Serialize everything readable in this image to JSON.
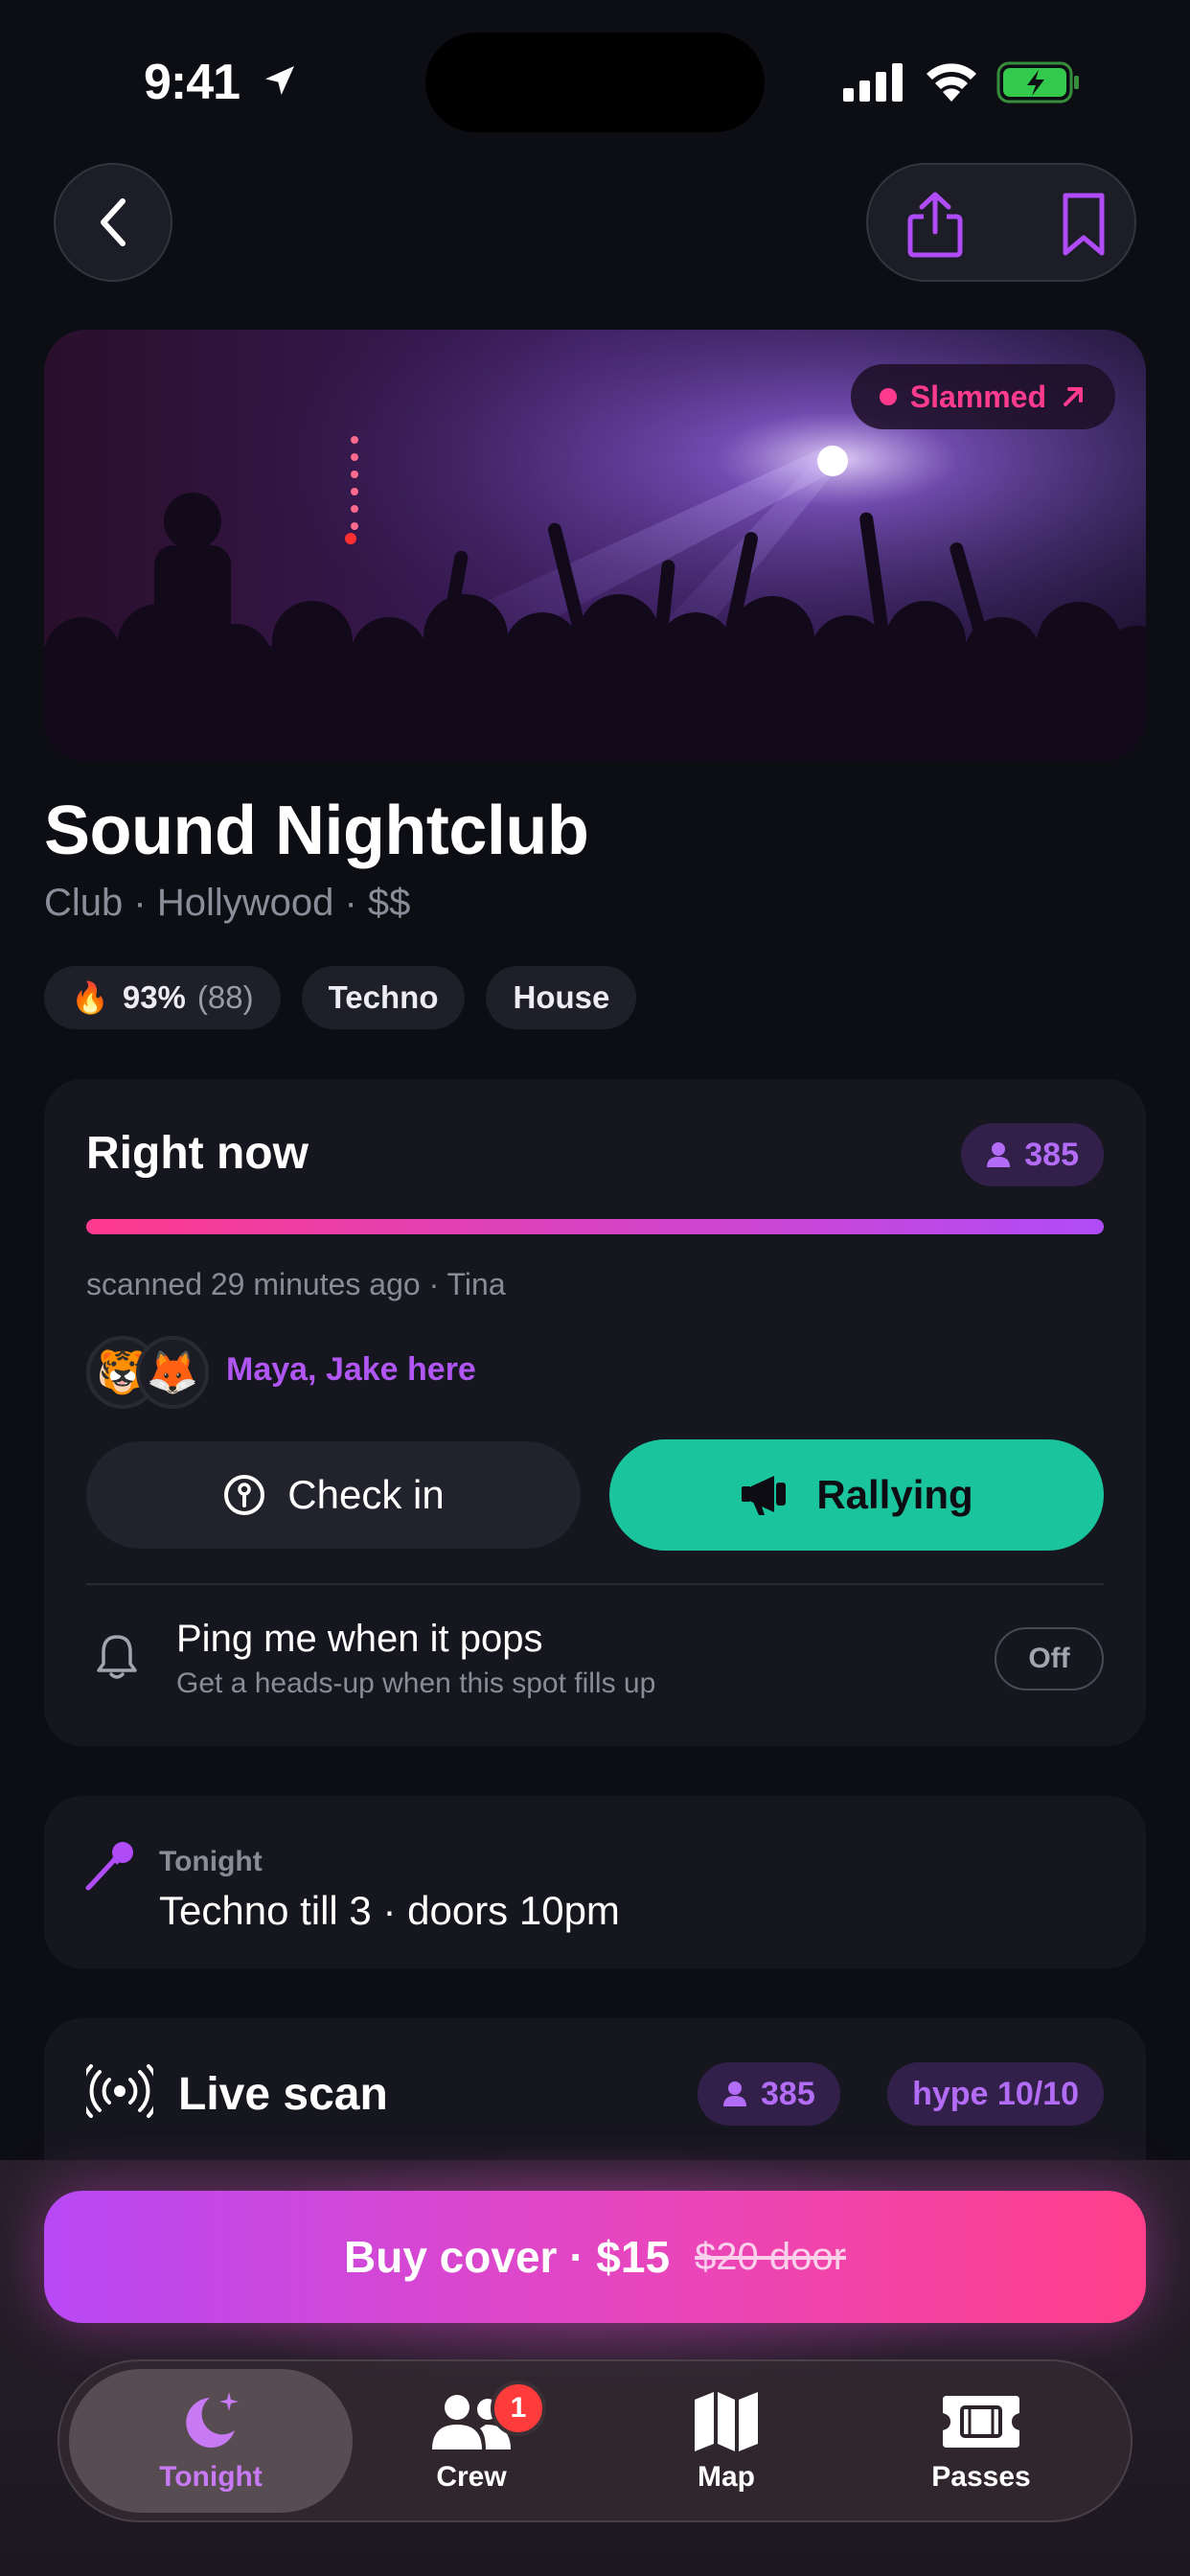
{
  "status_bar": {
    "time": "9:41"
  },
  "hero": {
    "badge": "Slammed"
  },
  "venue": {
    "name": "Sound Nightclub",
    "subtitle": "Club · Hollywood · $$",
    "chips": {
      "rating": "93%",
      "rating_count": "(88)",
      "genre1": "Techno",
      "genre2": "House"
    }
  },
  "now": {
    "title": "Right now",
    "count": "385",
    "crowd_level": 1.0,
    "scanned": "scanned 29 minutes ago · Tina",
    "friends_here": "Maya, Jake here",
    "checkin_label": "Check in",
    "rally_label": "Rallying",
    "ping_title": "Ping me when it pops",
    "ping_sub": "Get a heads-up when this spot fills up",
    "ping_state": "Off"
  },
  "tonight": {
    "label": "Tonight",
    "text": "Techno till 3 · doors 10pm"
  },
  "live_scan": {
    "title": "Live scan",
    "count": "385",
    "hype": "hype 10/10"
  },
  "buy": {
    "label": "Buy cover · $15",
    "door_price": "$20 door"
  },
  "tabs": [
    {
      "label": "Tonight",
      "icon": "moon-stars-icon"
    },
    {
      "label": "Crew",
      "icon": "people-icon",
      "badge": "1"
    },
    {
      "label": "Map",
      "icon": "map-icon"
    },
    {
      "label": "Passes",
      "icon": "ticket-icon"
    }
  ],
  "colors": {
    "accent_purple": "#b04cf7",
    "accent_pink": "#ff3b8e",
    "rally_green": "#1ac49c"
  }
}
